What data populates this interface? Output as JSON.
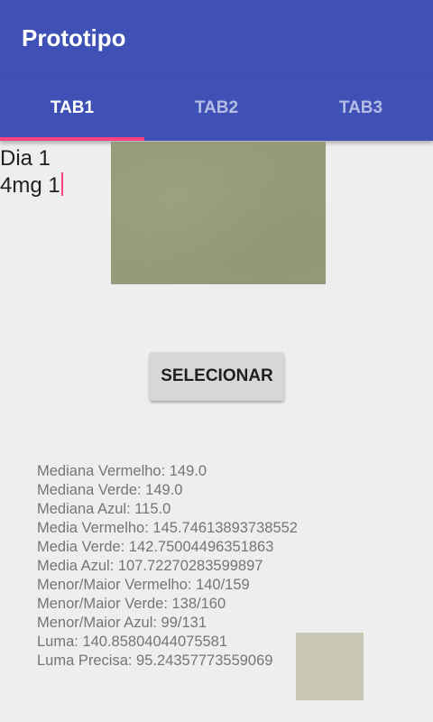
{
  "app_bar": {
    "title": "Prototipo"
  },
  "tabs": [
    {
      "label": "TAB1",
      "active": true
    },
    {
      "label": "TAB2",
      "active": false
    },
    {
      "label": "TAB3",
      "active": false
    }
  ],
  "colors": {
    "primary": "#3f51b5",
    "accent": "#ff4081",
    "sample_photo": "#959a79",
    "average_color_swatch": "#c9c8b5"
  },
  "note_input": {
    "lines": [
      "Dia 1",
      "4mg 1"
    ]
  },
  "select_button": {
    "label": "SELECIONAR"
  },
  "stats": [
    "Mediana Vermelho: 149.0",
    "Mediana Verde: 149.0",
    "Mediana Azul: 115.0",
    "Media Vermelho: 145.74613893738552",
    "Media Verde: 142.75004496351863",
    "Media Azul: 107.72270283599897",
    "Menor/Maior Vermelho: 140/159",
    "Menor/Maior Verde: 138/160",
    "Menor/Maior Azul: 99/131",
    "Luma: 140.85804044075581",
    "Luma Precisa: 95.24357773559069"
  ]
}
